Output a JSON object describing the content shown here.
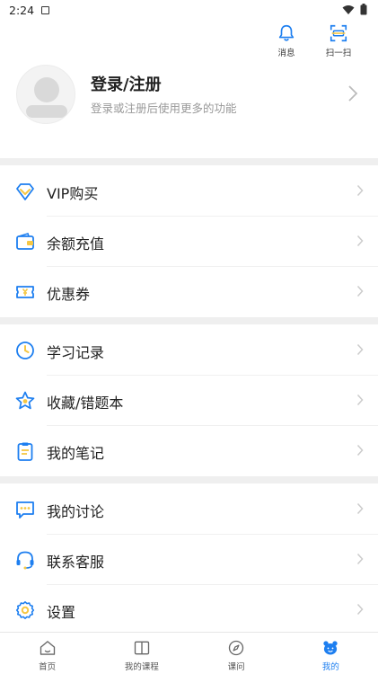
{
  "status_bar": {
    "time": "2:24"
  },
  "top_actions": {
    "messages_label": "消息",
    "scan_label": "扫一扫"
  },
  "profile": {
    "title": "登录/注册",
    "subtitle": "登录或注册后使用更多的功能"
  },
  "menu": {
    "group1": [
      {
        "label": "VIP购买",
        "icon": "diamond-icon"
      },
      {
        "label": "余额充值",
        "icon": "wallet-icon"
      },
      {
        "label": "优惠券",
        "icon": "coupon-icon"
      }
    ],
    "group2": [
      {
        "label": "学习记录",
        "icon": "clock-icon"
      },
      {
        "label": "收藏/错题本",
        "icon": "star-icon"
      },
      {
        "label": "我的笔记",
        "icon": "notebook-icon"
      }
    ],
    "group3": [
      {
        "label": "我的讨论",
        "icon": "chat-icon"
      },
      {
        "label": "联系客服",
        "icon": "headset-icon"
      },
      {
        "label": "设置",
        "icon": "gear-icon"
      }
    ]
  },
  "tabbar": {
    "tabs": [
      {
        "label": "首页",
        "icon": "home-icon"
      },
      {
        "label": "我的课程",
        "icon": "book-icon"
      },
      {
        "label": "课问",
        "icon": "compass-icon"
      },
      {
        "label": "我的",
        "icon": "bear-icon",
        "active": true
      }
    ]
  },
  "colors": {
    "accent": "#1e7ff0",
    "icon_yellow": "#f6c744",
    "divider": "#efefef"
  }
}
